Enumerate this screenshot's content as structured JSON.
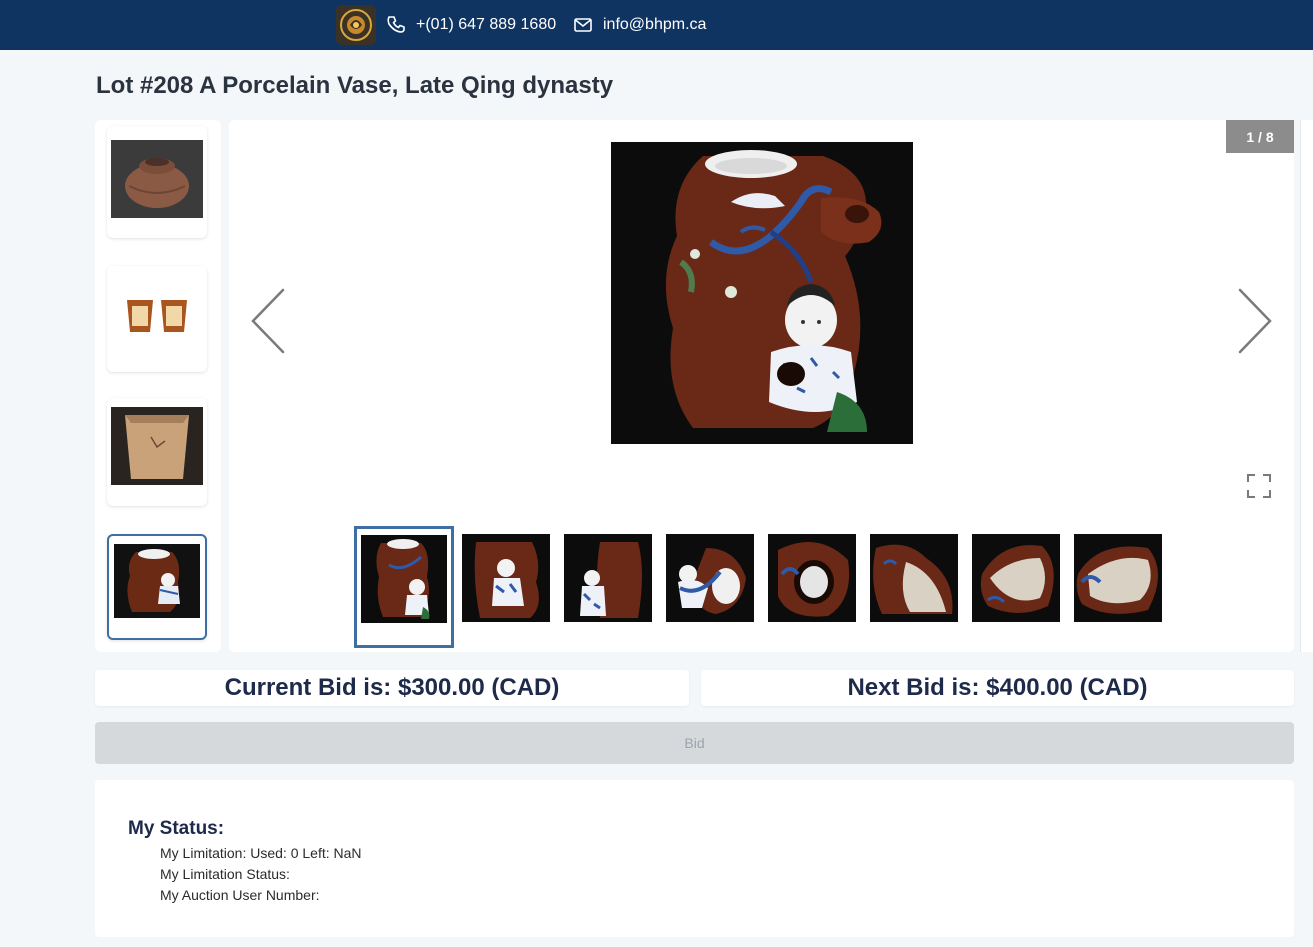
{
  "header": {
    "phone": "+(01) 647 889 1680",
    "email": "info@bhpm.ca",
    "logo_icon": "company-logo",
    "phone_icon": "phone-icon",
    "email_icon": "mail-icon",
    "background_color": "#0f3461"
  },
  "lot": {
    "title": "Lot #208 A Porcelain Vase, Late Qing dynasty"
  },
  "viewer": {
    "counter": "1 / 8",
    "prev_icon": "chevron-left-icon",
    "next_icon": "chevron-right-icon",
    "fullscreen_icon": "fullscreen-icon",
    "thumbnail_count": 8,
    "active_thumbnail": 1
  },
  "related_lots": [
    {
      "name": "brown-clay-jar-thumbnail"
    },
    {
      "name": "wooden-box-pair-thumbnail"
    },
    {
      "name": "clay-square-pot-thumbnail"
    },
    {
      "name": "porcelain-vase-thumbnail",
      "active": true
    }
  ],
  "bids": {
    "current": "Current Bid is: $300.00 (CAD)",
    "next": "Next Bid is: $400.00 (CAD)",
    "button_label": "Bid"
  },
  "status": {
    "title": "My Status:",
    "limitation": "My Limitation: Used: 0 Left: NaN",
    "limitation_status": "My Limitation Status:",
    "user_number": "My Auction User Number:"
  },
  "colors": {
    "accent": "#3d6fa2",
    "bid_text": "#1e2a4a",
    "disabled_button": "#d6d9dc"
  }
}
